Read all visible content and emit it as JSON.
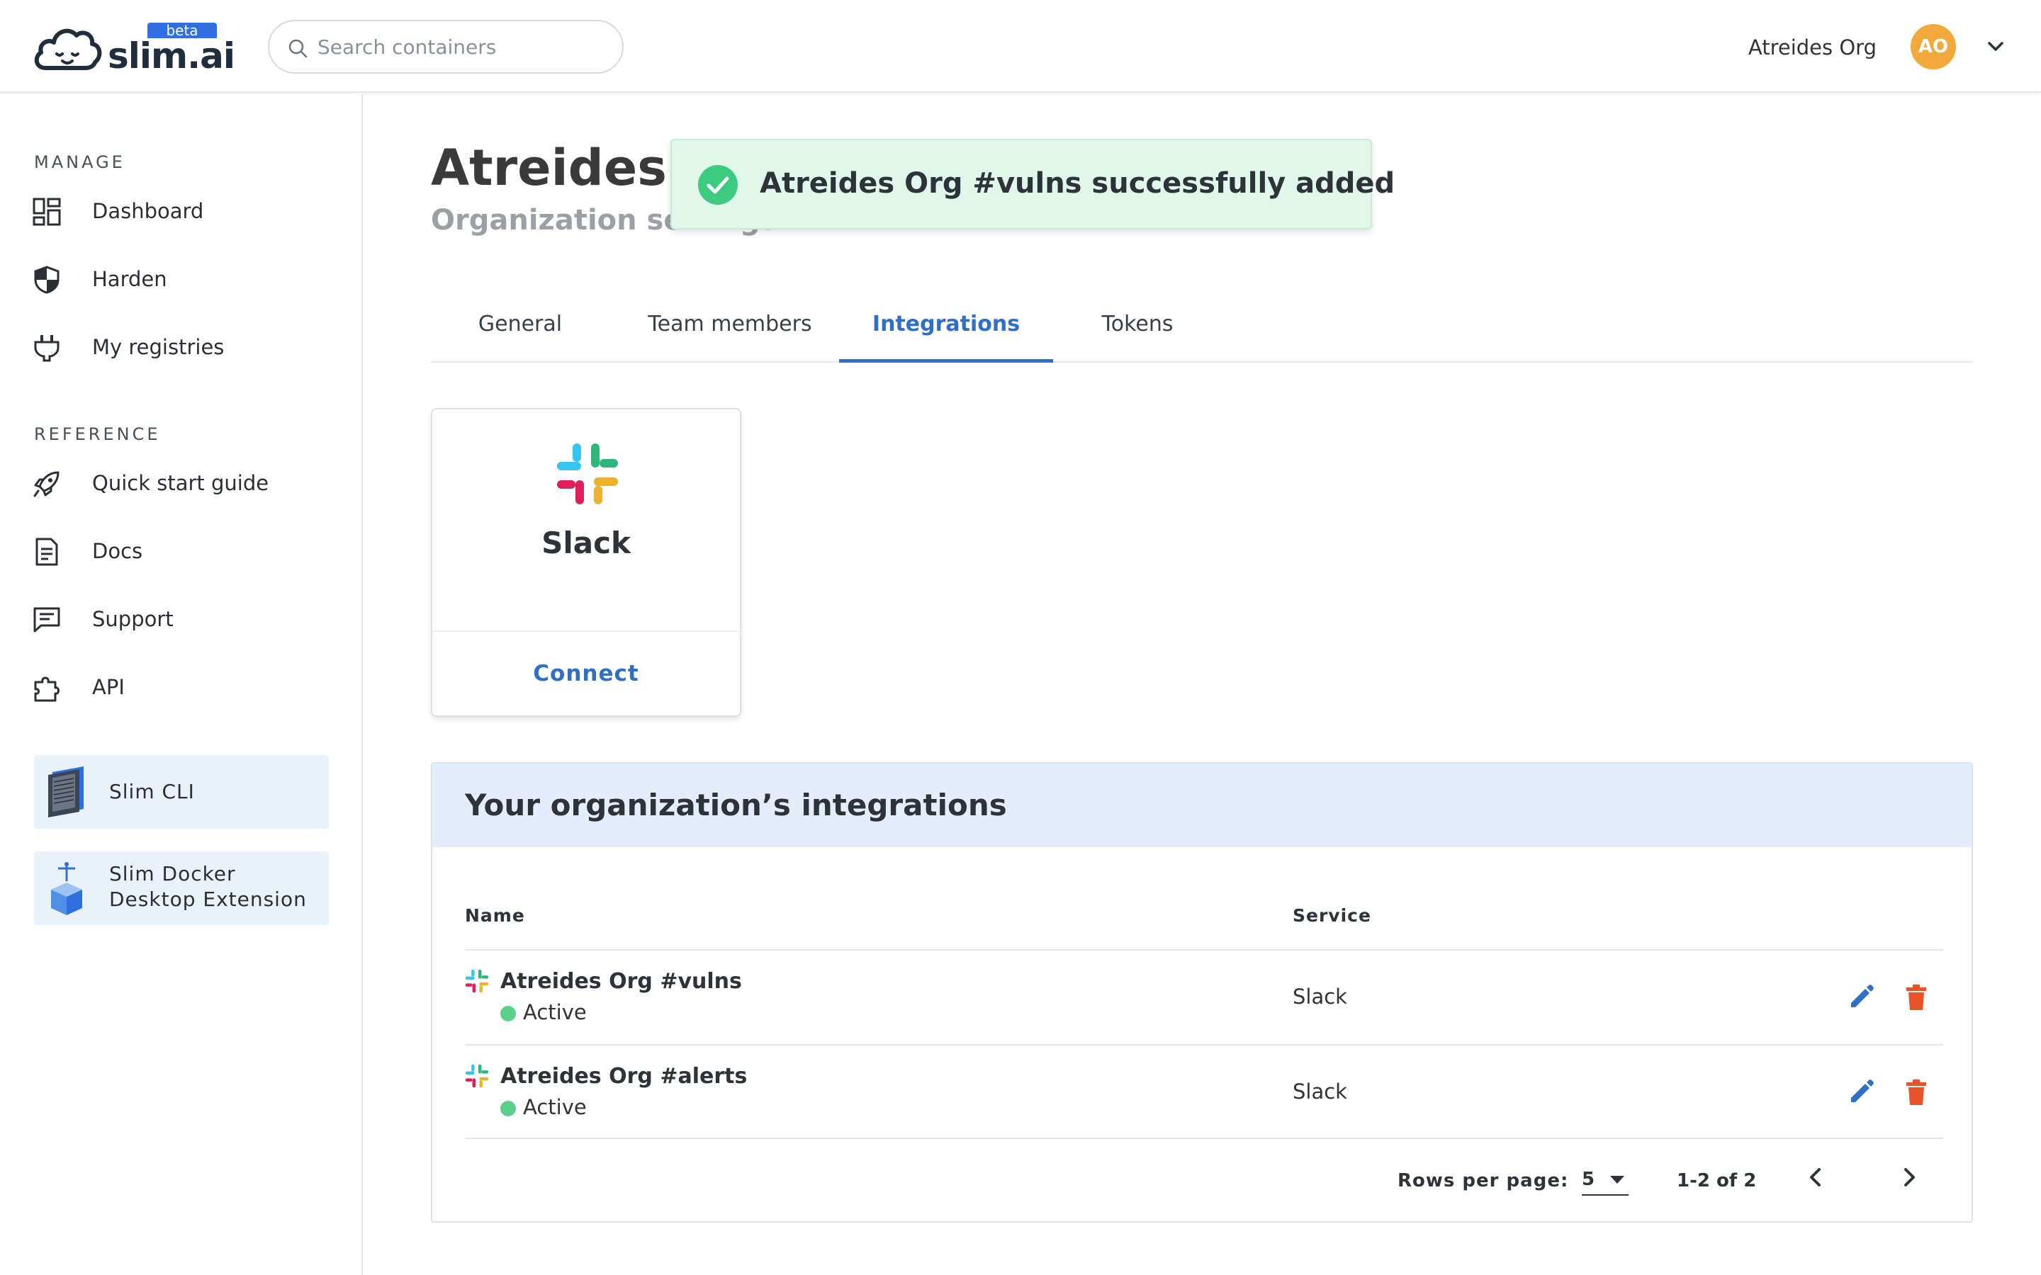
{
  "header": {
    "logo_text": "slim.ai",
    "beta_badge": "beta",
    "search": {
      "placeholder": "Search containers",
      "value": ""
    },
    "org_name": "Atreides Org",
    "avatar_initials": "AO"
  },
  "sidebar": {
    "manage_label": "MANAGE",
    "manage_items": [
      {
        "label": "Dashboard",
        "icon": "dashboard-icon"
      },
      {
        "label": "Harden",
        "icon": "shield-icon"
      },
      {
        "label": "My registries",
        "icon": "plug-icon"
      }
    ],
    "reference_label": "REFERENCE",
    "reference_items": [
      {
        "label": "Quick start guide",
        "icon": "rocket-icon"
      },
      {
        "label": "Docs",
        "icon": "document-icon"
      },
      {
        "label": "Support",
        "icon": "chat-icon"
      },
      {
        "label": "API",
        "icon": "puzzle-icon"
      }
    ],
    "promos": [
      {
        "label": "Slim CLI",
        "icon": "terminal-icon"
      },
      {
        "label_line1": "Slim Docker",
        "label_line2": "Desktop Extension",
        "icon": "docker-box-icon"
      }
    ]
  },
  "main": {
    "title": "Atreides Org",
    "subtitle": "Organization settings",
    "toast": {
      "message": "Atreides Org #vulns successfully added",
      "icon": "check-circle-icon"
    },
    "tabs": [
      {
        "label": "General",
        "active": false
      },
      {
        "label": "Team members",
        "active": false
      },
      {
        "label": "Integrations",
        "active": true
      },
      {
        "label": "Tokens",
        "active": false
      }
    ],
    "integration_card": {
      "name": "Slack",
      "action": "Connect",
      "icon": "slack-logo"
    },
    "integrations_panel": {
      "title": "Your organization’s integrations",
      "columns": {
        "name": "Name",
        "service": "Service"
      },
      "rows": [
        {
          "name": "Atreides Org #vulns",
          "status": "Active",
          "service": "Slack"
        },
        {
          "name": "Atreides Org #alerts",
          "status": "Active",
          "service": "Slack"
        }
      ],
      "pagination": {
        "rows_per_page_label": "Rows per page:",
        "rows_per_page": "5",
        "range": "1-2 of 2"
      }
    }
  },
  "colors": {
    "accent": "#2f6fc4",
    "brand_beta": "#2f6fde",
    "avatar": "#f2a93b",
    "toast_bg": "#dff8ea",
    "success": "#3ccb7f",
    "status_active": "#5bd08a",
    "delete": "#e8532a",
    "panel_header_bg": "#e4eefa"
  }
}
